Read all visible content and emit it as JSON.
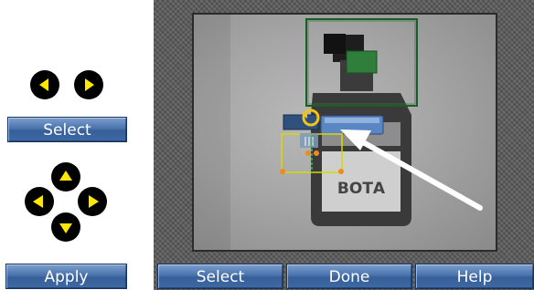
{
  "left_panel": {
    "select_label": "Select",
    "apply_label": "Apply",
    "arrow_color": "#ffe800",
    "arrow_bg": "#000000"
  },
  "viewer": {
    "bottle_label": "ВОТА",
    "toolbar": {
      "select_label": "Select",
      "done_label": "Done",
      "help_label": "Help"
    },
    "selection_color": "#1e5a2a",
    "handle_color": "#f08a1e",
    "crop_box_color": "#d8d800"
  }
}
